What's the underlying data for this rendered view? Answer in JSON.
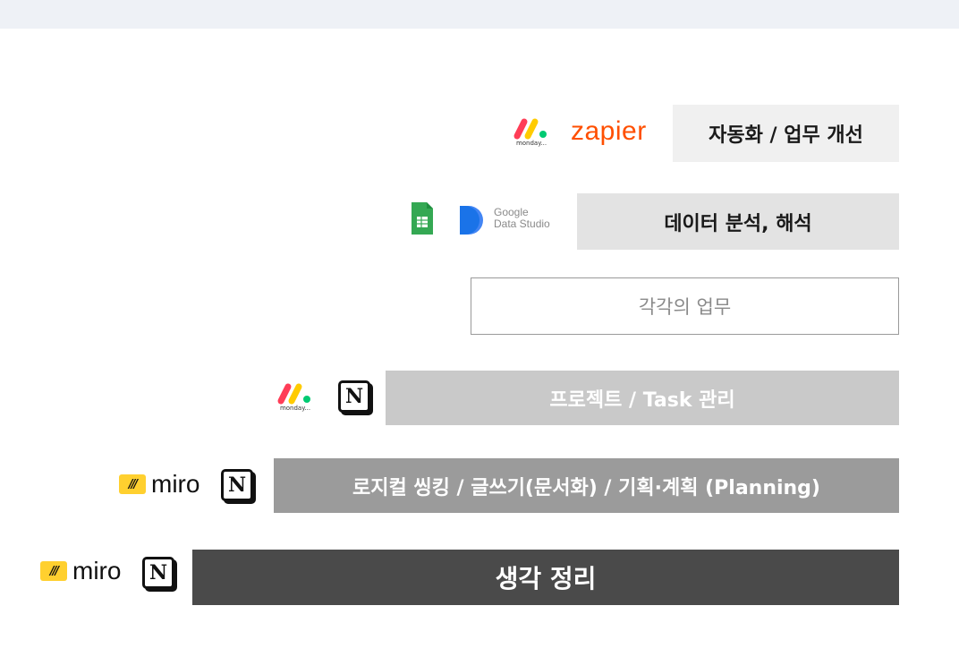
{
  "layers": {
    "automation": "자동화 / 업무 개선",
    "data_analysis": "데이터 분석, 해석",
    "each_work": "각각의 업무",
    "project": "프로젝트 / Task 관리",
    "logic": "로지컬 씽킹 / 글쓰기(문서화) / 기획·계획 (Planning)",
    "thinking": "생각 정리"
  },
  "logos": {
    "monday": "monday...",
    "zapier": "zapier",
    "google_data_studio_line1": "Google",
    "google_data_studio_line2": "Data Studio",
    "notion": "N",
    "miro": "miro"
  },
  "colors": {
    "zapier": "#ff4f00",
    "miro_yellow": "#ffd02f",
    "sheets_green": "#34a853",
    "gds_blue": "#4285f4"
  }
}
